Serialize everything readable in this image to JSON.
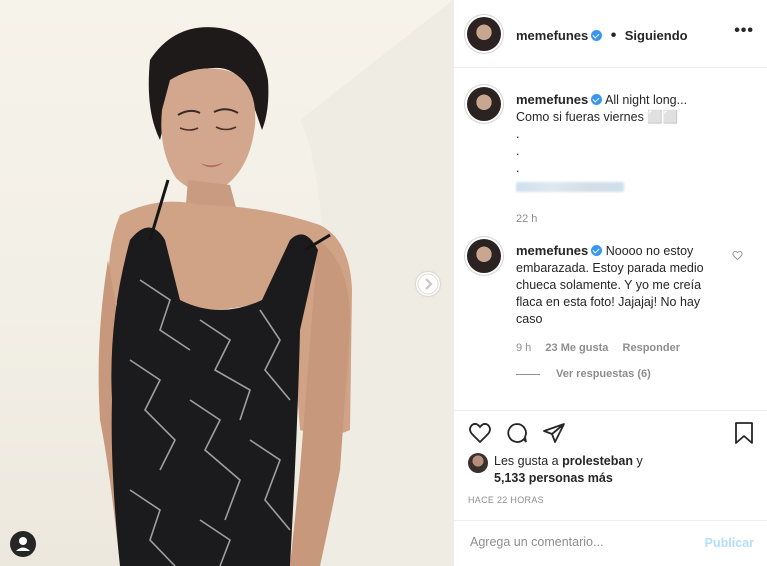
{
  "post": {
    "username": "memefunes",
    "follow_status": "Siguiendo",
    "more_glyph": "•••",
    "caption_lines": [
      "All night long...",
      "Como si fueras viernes ⬜⬜",
      ".",
      ".",
      "."
    ],
    "caption_time": "22 h"
  },
  "reply": {
    "username": "memefunes",
    "text": "Noooo no estoy embarazada. Estoy parada medio chueca solamente. Y yo me creía flaca en esta foto! Jajajaj! No hay caso",
    "time": "9 h",
    "likes": "23 Me gusta",
    "reply_label": "Responder",
    "view_replies": "Ver respuestas (6)"
  },
  "likes": {
    "liked_by_prefix": "Les gusta a",
    "liked_by_user": "prolesteban",
    "connector": "y",
    "others": "5,133 personas más"
  },
  "date_label": "HACE 22 HORAS",
  "comment_box": {
    "placeholder": "Agrega un comentario...",
    "publish_label": "Publicar"
  },
  "colors": {
    "verified": "#3897f0",
    "muted": "#8e8e8e",
    "publish_disabled": "#b2dffc"
  },
  "icons": [
    "chevron-right-icon",
    "user-tag-icon",
    "verified-icon",
    "heart-icon",
    "comment-icon",
    "share-icon",
    "bookmark-icon",
    "heart-small-icon"
  ]
}
